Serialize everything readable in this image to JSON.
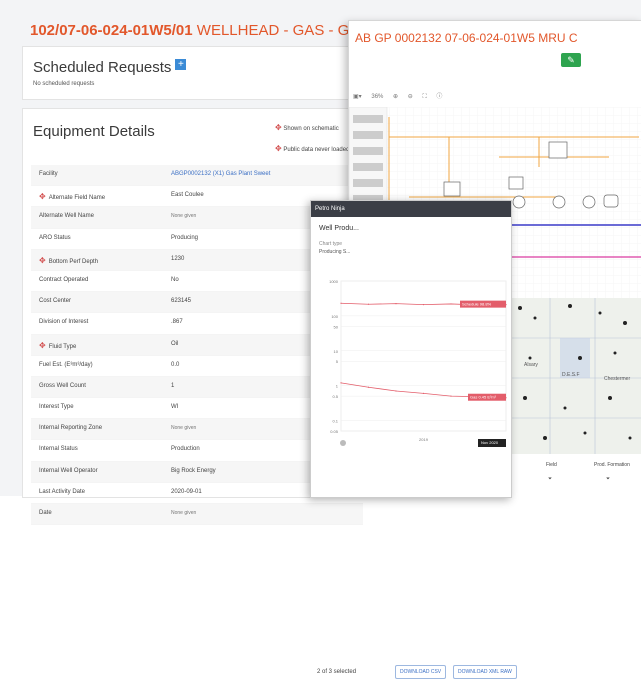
{
  "page": {
    "title_bold": "102/07-06-024-01W5/01",
    "title_rest": " WELLHEAD - GAS - GASPUMP"
  },
  "scheduled": {
    "title": "Scheduled Requests",
    "add": "+",
    "empty": "No scheduled requests"
  },
  "equipment": {
    "title": "Equipment Details",
    "legend_schematic": "Shown on schematic",
    "legend_public": "Public data never loaded",
    "rows": [
      {
        "label": "Facility",
        "value": "ABGP0002132 (X1) Gas Plant Sweet"
      },
      {
        "label": "Alternate Field Name",
        "value": "East Coulee"
      },
      {
        "label": "Alternate Well Name",
        "value": "None given"
      },
      {
        "label": "ARO Status",
        "value": "Producing"
      },
      {
        "label": "Bottom Perf Depth",
        "value": "1230"
      },
      {
        "label": "Contract Operated",
        "value": "No"
      },
      {
        "label": "Cost Center",
        "value": "623145"
      },
      {
        "label": "Division of Interest",
        "value": ".867"
      },
      {
        "label": "Fluid Type",
        "value": "Oil"
      },
      {
        "label": "Fuel Est. (E³m³/day)",
        "value": "0.0"
      },
      {
        "label": "Gross Well Count",
        "value": "1"
      },
      {
        "label": "Interest Type",
        "value": "WI"
      },
      {
        "label": "Internal Reporting Zone",
        "value": "None given"
      },
      {
        "label": "Internal Status",
        "value": "Production"
      },
      {
        "label": "Internal Well Operator",
        "value": "Big Rock Energy"
      },
      {
        "label": "Last Activity Date",
        "value": "2020-09-01"
      },
      {
        "label": "Date",
        "value": "None given"
      }
    ]
  },
  "schematic": {
    "title": "AB GP 0002132 07-06-024-01W5 MRU C",
    "zoom": "36%"
  },
  "chart_window": {
    "bar": "Petro Ninja",
    "title": "Well Produ...",
    "sub1": "Chart type",
    "sub2": "Producing S...",
    "selected": "2 of 3 selected",
    "download_csv": "DOWNLOAD CSV",
    "download_xml": "DOWNLOAD XML RAW",
    "label_top": "Schedule 98.8%",
    "label_gas": "Gas 0.45 E³m³",
    "tooltip": "Nov 2020",
    "xtick": "2019"
  },
  "chart_data": {
    "type": "line",
    "title": "Well Produ...",
    "ylabel": "",
    "yscale": "log",
    "y_ticks": [
      "1000",
      "100",
      "50",
      "10",
      "5",
      "1",
      "0.5",
      "0.1",
      "0.05"
    ],
    "x_ticks": [
      "2019"
    ],
    "series": [
      {
        "name": "Schedule",
        "color": "#e35d6a",
        "values": [
          230,
          215,
          225,
          210,
          220,
          205,
          210
        ]
      },
      {
        "name": "Gas",
        "color": "#e35d6a",
        "values": [
          1.2,
          0.9,
          0.7,
          0.6,
          0.5,
          0.48,
          0.45
        ]
      }
    ]
  },
  "map": {
    "labels": [
      "Alsary",
      "D.E.S.F",
      "Chestermer"
    ],
    "col_field": "Field",
    "col_formation": "Prod. Formation"
  },
  "colors": {
    "accent": "#e2572b",
    "edit_green": "#2ea44f",
    "link": "#3b6fc4"
  }
}
